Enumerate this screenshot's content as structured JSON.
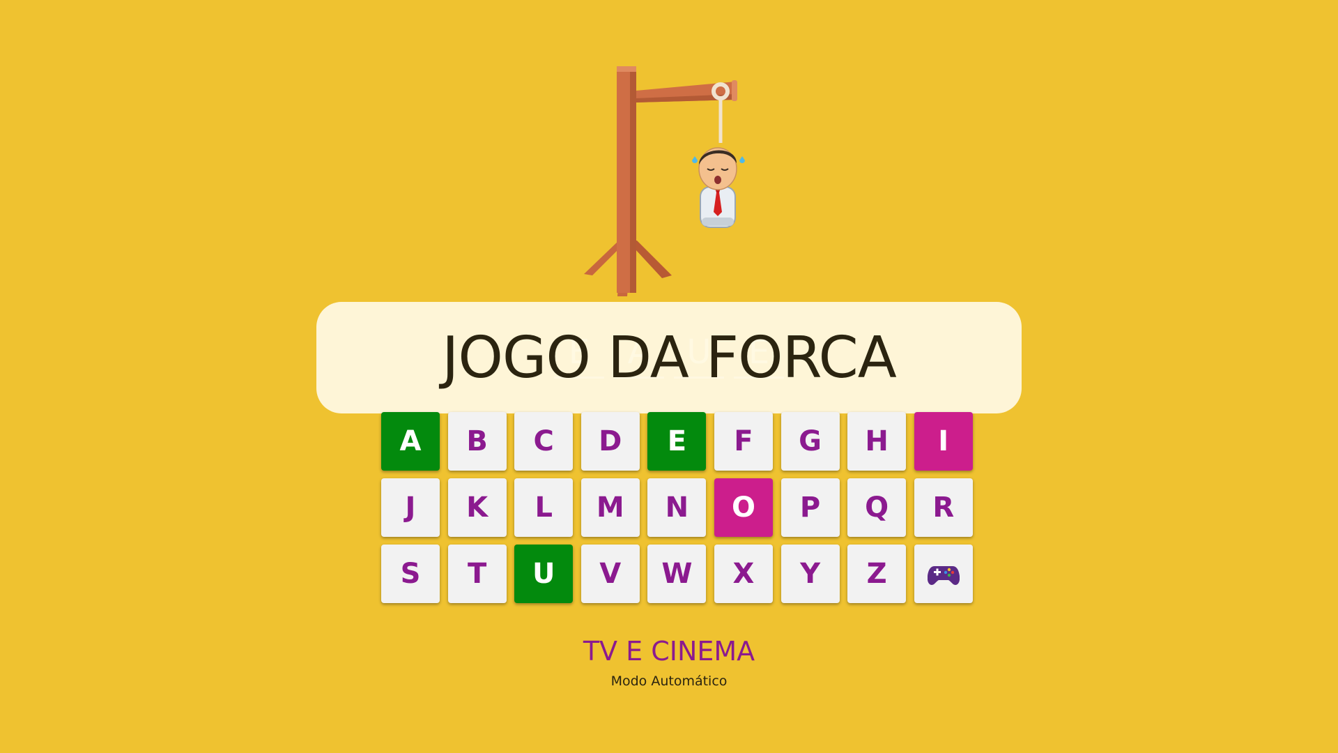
{
  "title": "JOGO DA FORCA",
  "word": {
    "slots": [
      "E",
      "A",
      "U",
      "E"
    ]
  },
  "keyboard": {
    "keys": [
      {
        "label": "A",
        "state": "correct"
      },
      {
        "label": "B",
        "state": "unused"
      },
      {
        "label": "C",
        "state": "unused"
      },
      {
        "label": "D",
        "state": "unused"
      },
      {
        "label": "E",
        "state": "correct"
      },
      {
        "label": "F",
        "state": "unused"
      },
      {
        "label": "G",
        "state": "unused"
      },
      {
        "label": "H",
        "state": "unused"
      },
      {
        "label": "I",
        "state": "wrong"
      },
      {
        "label": "J",
        "state": "unused"
      },
      {
        "label": "K",
        "state": "unused"
      },
      {
        "label": "L",
        "state": "unused"
      },
      {
        "label": "M",
        "state": "unused"
      },
      {
        "label": "N",
        "state": "unused"
      },
      {
        "label": "O",
        "state": "wrong"
      },
      {
        "label": "P",
        "state": "unused"
      },
      {
        "label": "Q",
        "state": "unused"
      },
      {
        "label": "R",
        "state": "unused"
      },
      {
        "label": "S",
        "state": "unused"
      },
      {
        "label": "T",
        "state": "unused"
      },
      {
        "label": "U",
        "state": "correct"
      },
      {
        "label": "V",
        "state": "unused"
      },
      {
        "label": "W",
        "state": "unused"
      },
      {
        "label": "X",
        "state": "unused"
      },
      {
        "label": "Y",
        "state": "unused"
      },
      {
        "label": "Z",
        "state": "unused"
      }
    ],
    "extra_button_icon": "gamepad-icon"
  },
  "category": "TV E CINEMA",
  "mode": "Modo Automático",
  "colors": {
    "background": "#efc230",
    "correct": "#038a0d",
    "wrong": "#cc1e8c",
    "key_text": "#8b1a8f",
    "key_bg": "#f2f2f2"
  }
}
